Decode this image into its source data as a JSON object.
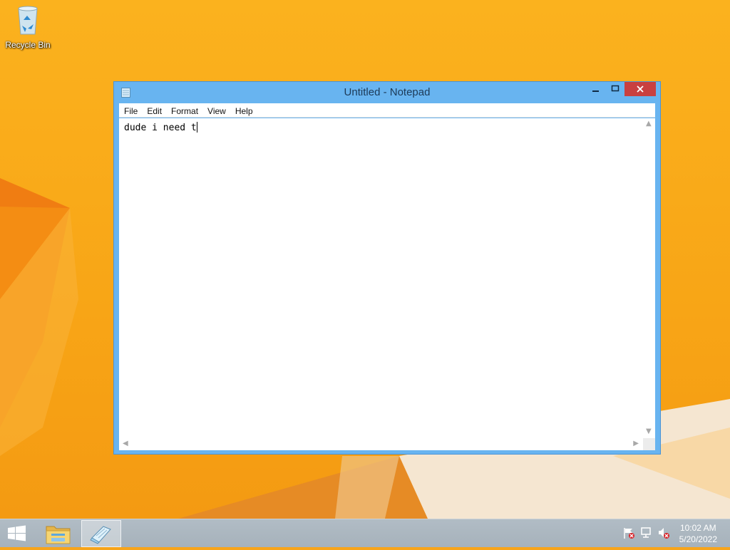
{
  "desktop": {
    "icons": [
      {
        "label": "Recycle Bin",
        "icon": "recycle-bin-icon"
      }
    ]
  },
  "window": {
    "title": "Untitled - Notepad",
    "controls": {
      "minimize": "—",
      "maximize": "□",
      "close": "✕"
    },
    "menu": [
      "File",
      "Edit",
      "Format",
      "View",
      "Help"
    ],
    "editor_text": "dude i need t"
  },
  "taskbar": {
    "buttons": [
      {
        "name": "File Explorer",
        "icon": "folder-icon"
      },
      {
        "name": "Notepad",
        "icon": "notepad-icon",
        "active": true
      }
    ],
    "tray_icons": [
      "action-center-flag-icon",
      "network-icon",
      "speaker-muted-icon"
    ],
    "clock": {
      "time": "10:02 AM",
      "date": "5/20/2022"
    }
  },
  "colors": {
    "desktop_background": "#f8a516",
    "window_frame": "#68b4f0",
    "close_button": "#c94040",
    "taskbar": "#a9b5be"
  }
}
